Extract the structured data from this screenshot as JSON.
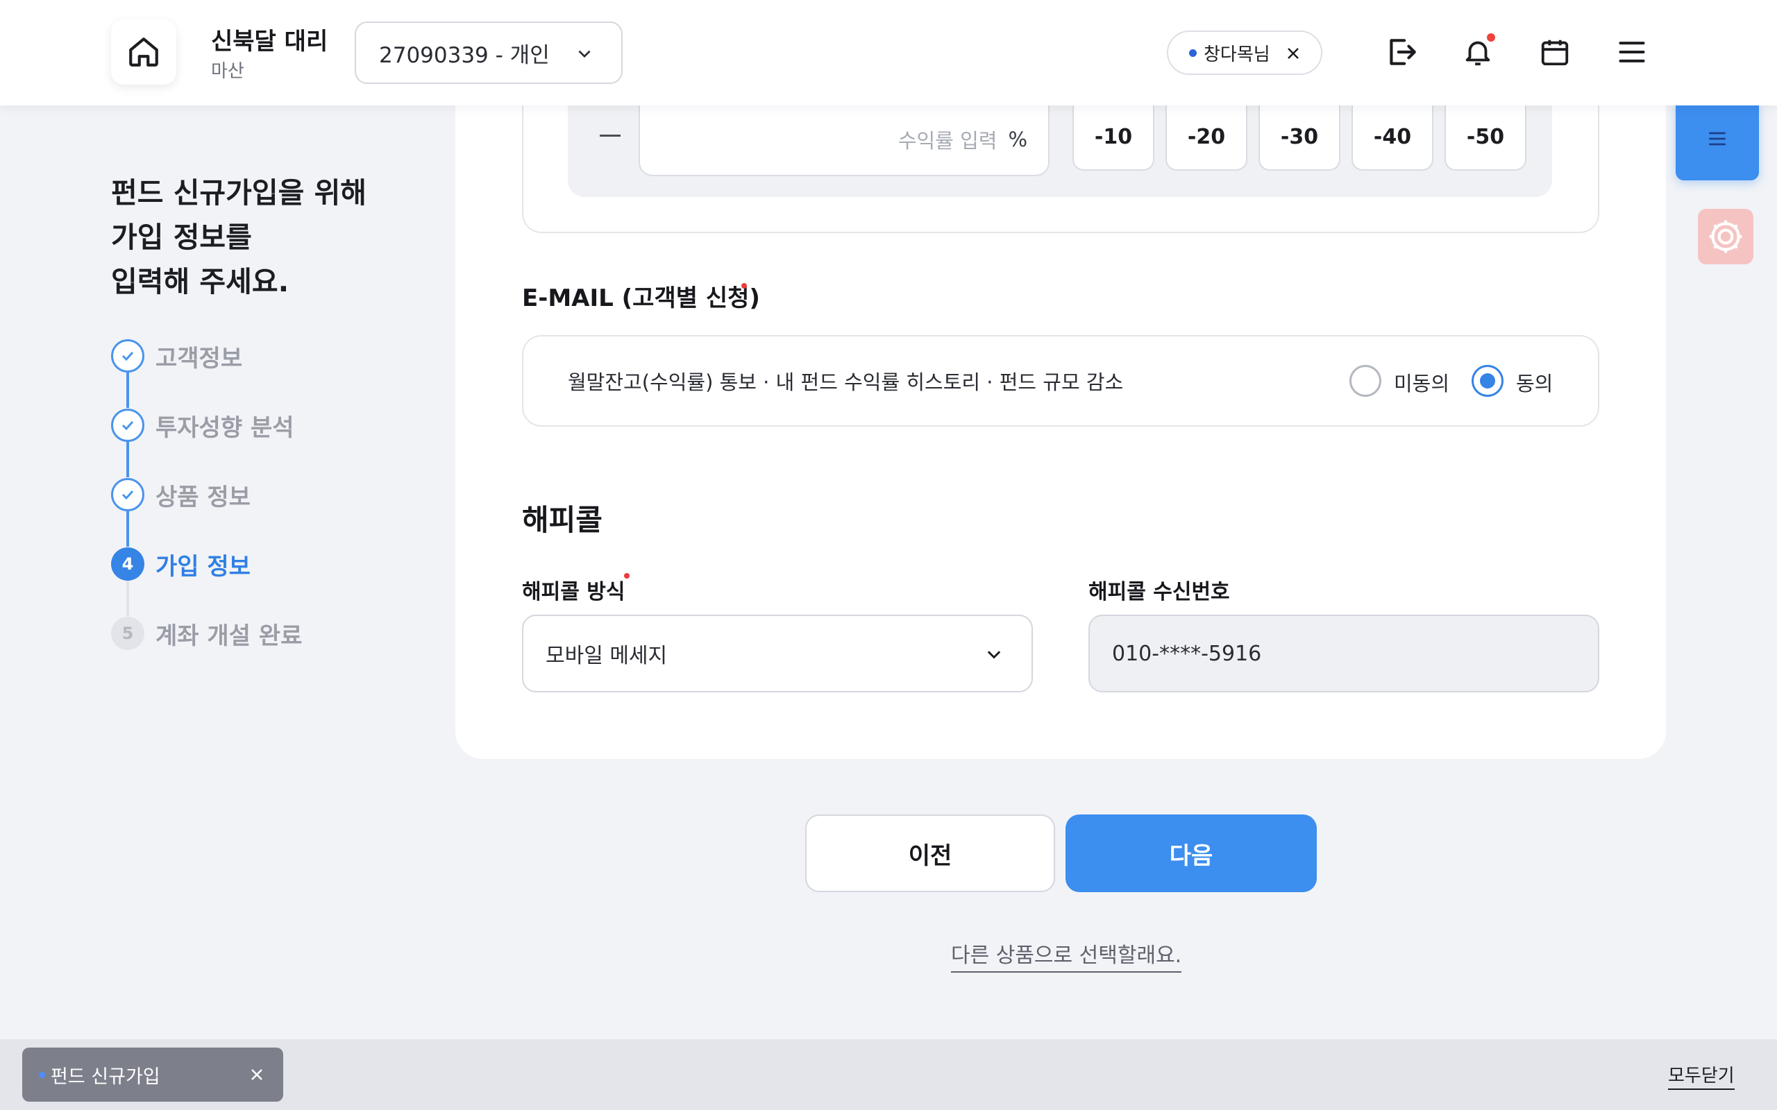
{
  "header": {
    "user_name": "신북달 대리",
    "user_branch": "마산",
    "account_value": "27090339 - 개인",
    "customer_chip": "창다목님"
  },
  "sidebar": {
    "intro": "펀드 신규가입을 위해\n가입 정보를\n입력해 주세요.",
    "steps": [
      {
        "label": "고객정보",
        "state": "done"
      },
      {
        "label": "투자성향 분석",
        "state": "done"
      },
      {
        "label": "상품 정보",
        "state": "done"
      },
      {
        "label": "가입 정보",
        "state": "active",
        "number": "4"
      },
      {
        "label": "계좌 개설 완료",
        "state": "todo",
        "number": "5"
      }
    ]
  },
  "rate": {
    "input_placeholder": "수익률 입력",
    "unit": "%",
    "presets": [
      "-10",
      "-20",
      "-30",
      "-40",
      "-50"
    ]
  },
  "email": {
    "title": "E-MAIL (고객별 신청)",
    "description": "월말잔고(수익률) 통보 · 내 펀드 수익률 히스토리 · 펀드 규모 감소",
    "options": [
      "미동의",
      "동의"
    ],
    "selected": "동의"
  },
  "happycall": {
    "title": "해피콜",
    "method_label": "해피콜 방식",
    "method_value": "모바일 메세지",
    "phone_label": "해피콜 수신번호",
    "phone_value": "010-****-5916"
  },
  "actions": {
    "prev_label": "이전",
    "next_label": "다음",
    "other_product_link": "다른 상품으로 선택할래요."
  },
  "tabbar": {
    "open_tab": "펀드 신규가입",
    "close_all": "모두닫기"
  },
  "colors": {
    "accent": "#3c8eef",
    "required": "#ec3b3b",
    "notification": "#f0433a"
  }
}
